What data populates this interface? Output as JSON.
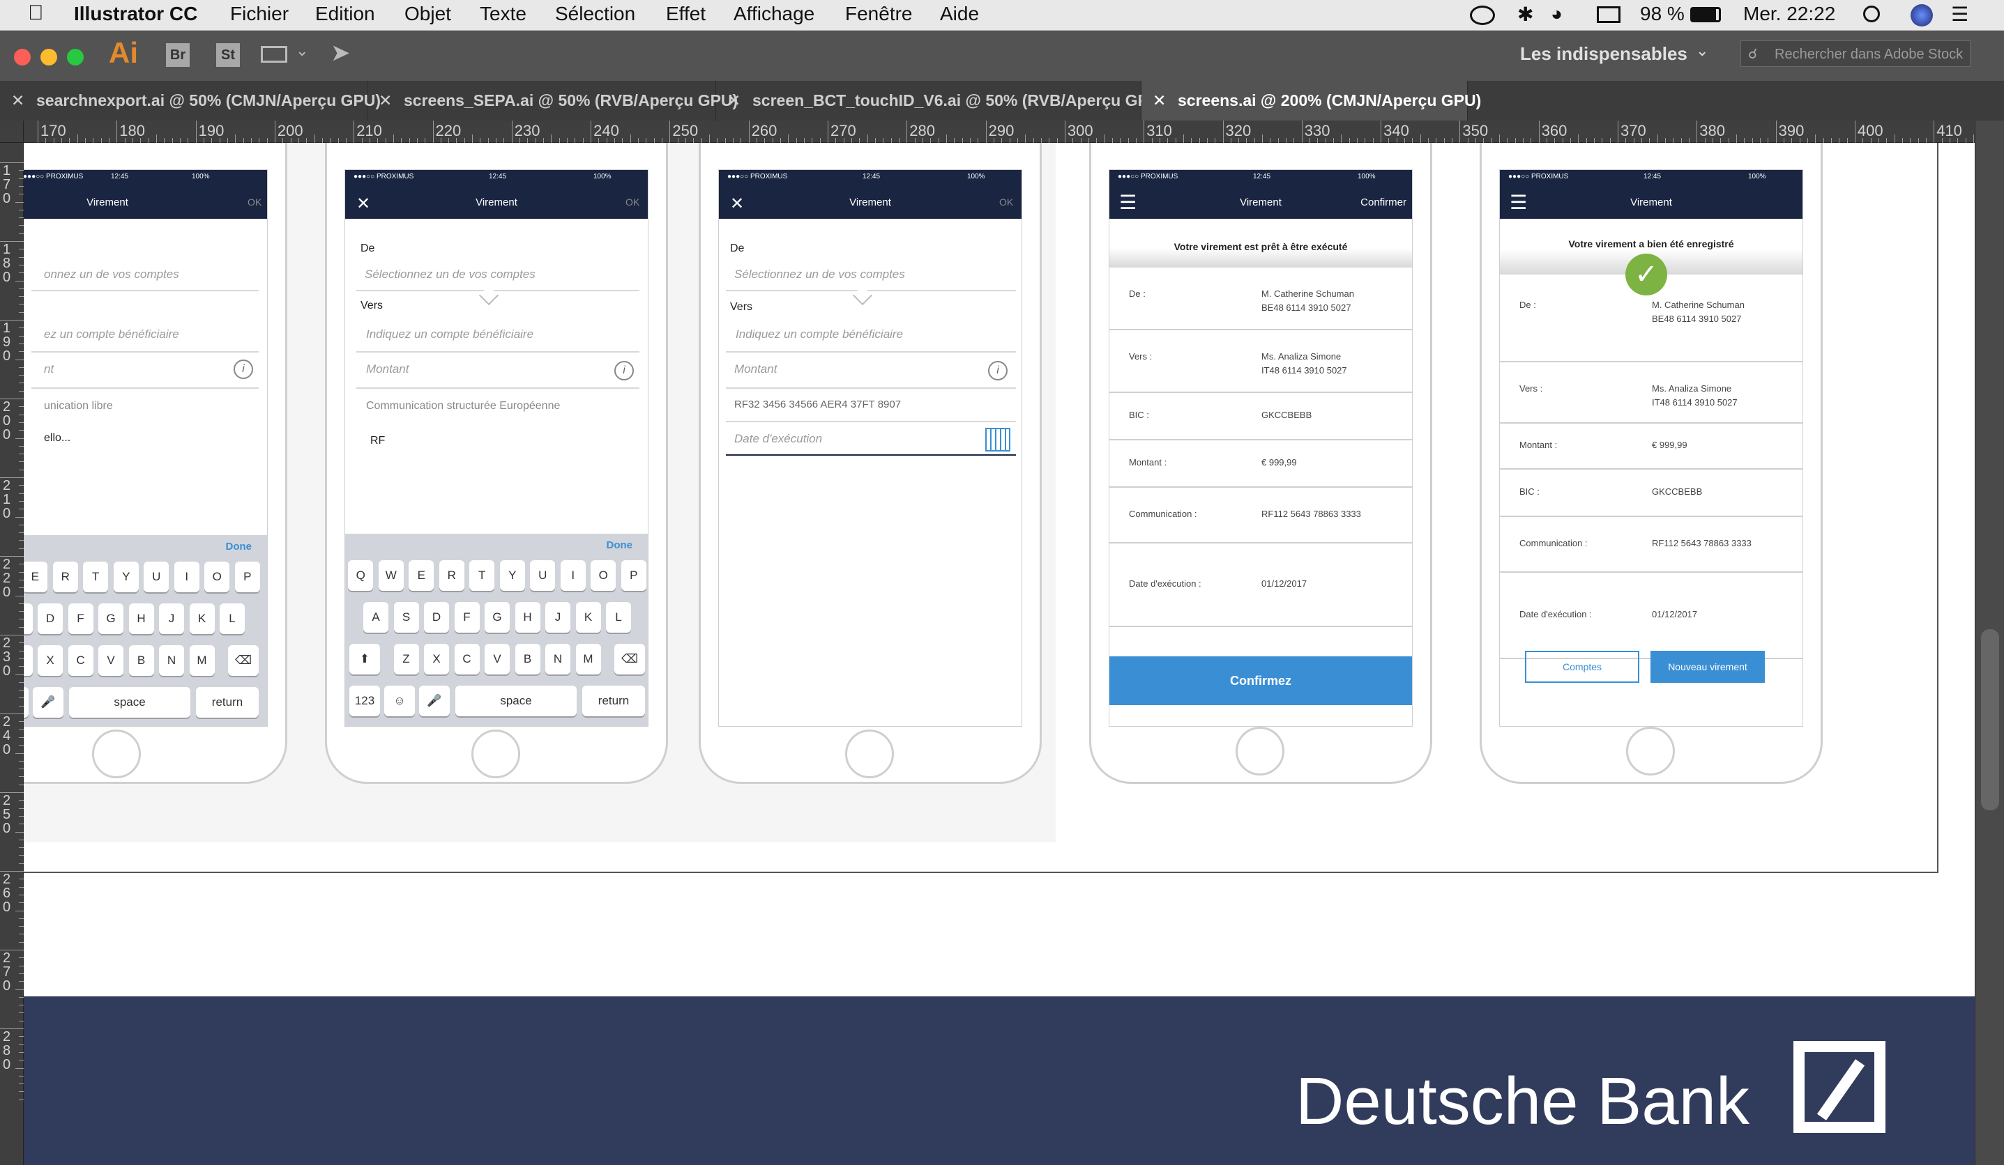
{
  "menubar": {
    "app": "Illustrator CC",
    "items": [
      "Fichier",
      "Edition",
      "Objet",
      "Texte",
      "Sélection",
      "Effet",
      "Affichage",
      "Fenêtre",
      "Aide"
    ],
    "battery": "98 %",
    "clock": "Mer. 22:22"
  },
  "toolbar": {
    "ai": "Ai",
    "br": "Br",
    "st": "St",
    "workspace": "Les indispensables",
    "search_placeholder": "Rechercher dans Adobe Stock"
  },
  "tabs": [
    {
      "label": "searchnexport.ai @ 50% (CMJN/Aperçu GPU)"
    },
    {
      "label": "screens_SEPA.ai @ 50% (RVB/Aperçu GPU)"
    },
    {
      "label": "screen_BCT_touchID_V6.ai @ 50% (RVB/Aperçu GPU)"
    },
    {
      "label": "screens.ai @ 200% (CMJN/Aperçu GPU)"
    }
  ],
  "ruler": {
    "h": [
      "170",
      "180",
      "190",
      "200",
      "210",
      "220",
      "230",
      "240",
      "250",
      "260",
      "270",
      "280",
      "290",
      "300",
      "310",
      "320",
      "330",
      "340",
      "350",
      "360",
      "370",
      "380",
      "390",
      "400",
      "410"
    ],
    "v": [
      "170",
      "180",
      "190",
      "200",
      "210",
      "220",
      "230",
      "240",
      "250",
      "260",
      "270",
      "280"
    ]
  },
  "status": {
    "carrier": "●●●○○ PROXIMUS",
    "time": "12:45",
    "batt": "100%"
  },
  "form": {
    "title": "Virement",
    "ok": "OK",
    "de": "De",
    "de_ph": "Sélectionnez un de vos comptes",
    "vers": "Vers",
    "vers_ph": "Indiquez un compte bénéficiaire",
    "montant": "Montant",
    "comm_euro": "Communication structurée Européenne",
    "rf": "RF",
    "rf_value": "RF32 3456 34566 AER4 37FT 8907",
    "date_ph": "Date d'exécution",
    "done": "Done"
  },
  "phone1": {
    "de_ph": "onnez un de vos comptes",
    "vers_ph": "ez un compte bénéficiaire",
    "montant": "nt",
    "comm": "unication libre",
    "msg": "ello..."
  },
  "keyboard": {
    "row1": [
      "Q",
      "W",
      "E",
      "R",
      "T",
      "Y",
      "U",
      "I",
      "O",
      "P"
    ],
    "row2": [
      "A",
      "S",
      "D",
      "F",
      "G",
      "H",
      "J",
      "K",
      "L"
    ],
    "row3": [
      "Z",
      "X",
      "C",
      "V",
      "B",
      "N",
      "M"
    ],
    "k123": "123",
    "space": "space",
    "return": "return"
  },
  "confirm": {
    "nav_title": "Virement",
    "nav_right": "Confirmer",
    "heading": "Votre virement est prêt à être exécuté",
    "rows": [
      {
        "label": "De :",
        "v1": "M. Catherine Schuman",
        "v2": "BE48 6114 3910 5027"
      },
      {
        "label": "Vers :",
        "v1": "Ms. Analiza Simone",
        "v2": "IT48 6114 3910 5027"
      },
      {
        "label": "BIC :",
        "v1": "GKCCBEBB",
        "v2": ""
      },
      {
        "label": "Montant :",
        "v1": "€ 999,99",
        "v2": ""
      },
      {
        "label": "Communication :",
        "v1": "RF112 5643 78863 3333",
        "v2": ""
      },
      {
        "label": "Date d'exécution :",
        "v1": "01/12/2017",
        "v2": ""
      }
    ],
    "button": "Confirmez"
  },
  "success": {
    "nav_title": "Virement",
    "heading": "Votre virement a bien été enregistré",
    "rows": [
      {
        "label": "De :",
        "v1": "M. Catherine Schuman",
        "v2": "BE48 6114 3910 5027"
      },
      {
        "label": "Vers :",
        "v1": "Ms. Analiza Simone",
        "v2": "IT48 6114 3910 5027"
      },
      {
        "label": "Montant :",
        "v1": "€ 999,99",
        "v2": ""
      },
      {
        "label": "BIC :",
        "v1": "GKCCBEBB",
        "v2": ""
      },
      {
        "label": "Communication :",
        "v1": "RF112 5643 78863 3333",
        "v2": ""
      },
      {
        "label": "Date d'exécution :",
        "v1": "01/12/2017",
        "v2": ""
      }
    ],
    "btn_secondary": "Comptes",
    "btn_primary": "Nouveau virement"
  },
  "brand": {
    "name": "Deutsche Bank"
  },
  "colors": {
    "nav": "#1a2541",
    "accent": "#3a8fd4",
    "success": "#7cb342",
    "footer": "#313b5c"
  }
}
